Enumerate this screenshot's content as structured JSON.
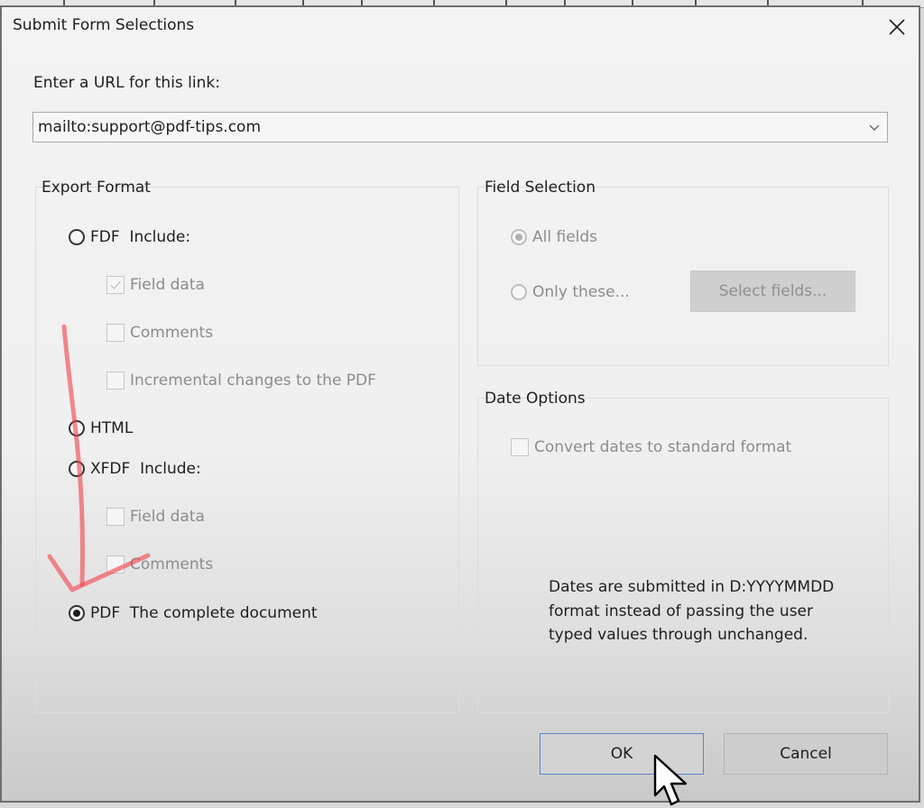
{
  "dialog": {
    "title": "Submit Form Selections",
    "close_icon": "close-icon"
  },
  "url": {
    "label": "Enter a URL for this link:",
    "value": "mailto:support@pdf-tips.com",
    "dropdown_icon": "chevron-down-icon"
  },
  "export_format": {
    "title": "Export Format",
    "options": [
      {
        "label": "FDF  Include:",
        "checked": false
      },
      {
        "label": "HTML",
        "checked": false
      },
      {
        "label": "XFDF  Include:",
        "checked": false
      },
      {
        "label": "PDF  The complete document",
        "checked": true
      }
    ],
    "fdf_includes": [
      {
        "label": "Field data",
        "checked": true,
        "enabled": false
      },
      {
        "label": "Comments",
        "checked": false,
        "enabled": false
      },
      {
        "label": "Incremental changes to the PDF",
        "checked": false,
        "enabled": false
      }
    ],
    "xfdf_includes": [
      {
        "label": "Field data",
        "checked": false,
        "enabled": false
      },
      {
        "label": "Comments",
        "checked": false,
        "enabled": false
      }
    ]
  },
  "field_selection": {
    "title": "Field Selection",
    "all_fields": "All fields",
    "only_these": "Only these...",
    "select_fields_button": "Select fields..."
  },
  "date_options": {
    "title": "Date Options",
    "convert_label": "Convert dates to standard format",
    "help_text": "Dates are submitted in D:YYYYMMDD format instead of passing the user typed values through unchanged."
  },
  "buttons": {
    "ok": "OK",
    "cancel": "Cancel"
  },
  "colors": {
    "annotation_arrow": "#f0404a",
    "ok_focus_border": "#5b86c9"
  }
}
